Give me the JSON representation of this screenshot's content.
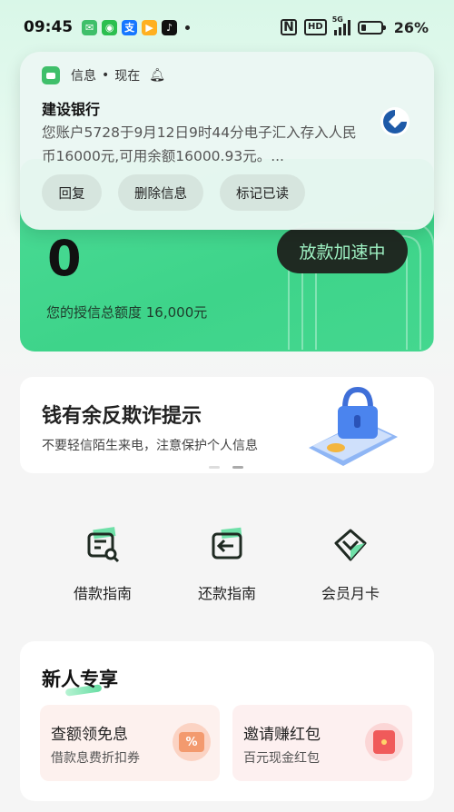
{
  "status_bar": {
    "time": "09:45",
    "network": "5G",
    "hd": "HD",
    "battery": "26%",
    "app_icons": [
      {
        "name": "messages-app-icon",
        "color": "#3fbf6a",
        "glyph": "✉"
      },
      {
        "name": "wechat-app-icon",
        "color": "#2bbf4f",
        "glyph": "◉"
      },
      {
        "name": "alipay-app-icon",
        "color": "#1677ff",
        "glyph": "支"
      },
      {
        "name": "video-app-icon",
        "color": "#ffb020",
        "glyph": "▶"
      },
      {
        "name": "tiktok-app-icon",
        "color": "#111111",
        "glyph": "♪"
      }
    ]
  },
  "notification": {
    "app": "信息",
    "separator": "•",
    "time": "现在",
    "sender": "建设银行",
    "body": "您账户5728于9月12日9时44分电子汇入存入人民币16000元,可用余额16000.93元。...",
    "actions": [
      "回复",
      "删除信息",
      "标记已读"
    ]
  },
  "credit_card": {
    "amount": "0",
    "button": "放款加速中",
    "label": "您的授信总额度 16,000元"
  },
  "fraud_banner": {
    "title": "钱有余反欺诈提示",
    "subtitle": "不要轻信陌生来电，注意保护个人信息"
  },
  "quick_links": [
    {
      "label": "借款指南",
      "icon": "loan-guide-icon"
    },
    {
      "label": "还款指南",
      "icon": "repay-guide-icon"
    },
    {
      "label": "会员月卡",
      "icon": "member-card-icon"
    }
  ],
  "new_user": {
    "title": "新人专享",
    "promos": [
      {
        "title": "查额领免息",
        "subtitle": "借款息费折扣券",
        "color": "#fdf1ee"
      },
      {
        "title": "邀请赚红包",
        "subtitle": "百元现金红包",
        "color": "#fdf0f0"
      }
    ]
  },
  "colors": {
    "accent": "#3ed48a",
    "dark_button": "#1f2a22"
  }
}
